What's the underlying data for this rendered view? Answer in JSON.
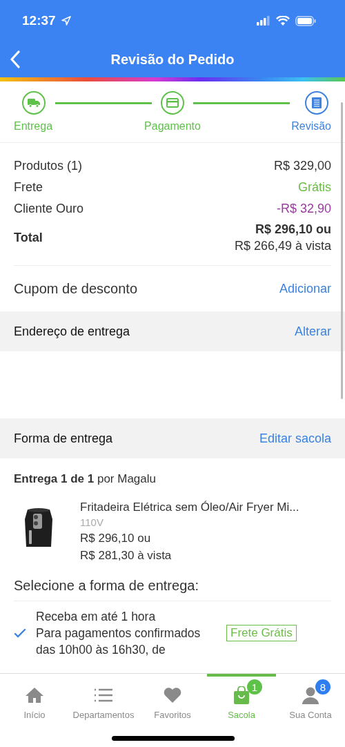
{
  "status_bar": {
    "time": "12:37"
  },
  "header": {
    "title": "Revisão do Pedido"
  },
  "steps": [
    {
      "label": "Entrega",
      "done": true,
      "kind": "truck"
    },
    {
      "label": "Pagamento",
      "done": true,
      "kind": "card"
    },
    {
      "label": "Revisão",
      "done": false,
      "kind": "doc"
    }
  ],
  "summary": [
    {
      "label": "Produtos (1)",
      "value": "R$ 329,00",
      "kind": "plain"
    },
    {
      "label": "Frete",
      "value": "Grátis",
      "kind": "free"
    },
    {
      "label": "Cliente Ouro",
      "value": "-R$ 32,90",
      "kind": "discount"
    }
  ],
  "total": {
    "label": "Total",
    "value": "R$ 296,10 ou",
    "cash": "R$ 266,49 à vista"
  },
  "coupon": {
    "label": "Cupom de desconto",
    "action": "Adicionar"
  },
  "address": {
    "title": "Endereço de entrega",
    "action": "Alterar"
  },
  "delivery": {
    "title": "Forma de entrega",
    "action": "Editar sacola",
    "shipment": "Entrega 1 de 1",
    "seller": "por Magalu"
  },
  "product": {
    "name": "Fritadeira Elétrica sem Óleo/Air Fryer Mi...",
    "variant": "110V",
    "price": "R$ 296,10 ou",
    "cash": "R$ 281,30 à vista"
  },
  "options_title": "Selecione a forma de entrega:",
  "options": [
    {
      "title": "Receba em até 1 hora",
      "description": "Para pagamentos confirmados das 10h00 às 16h30, de",
      "tag": "Frete Grátis",
      "selected": true
    }
  ],
  "tab_bar": [
    {
      "label": "Início",
      "kind": "home",
      "selected": false
    },
    {
      "label": "Departamentos",
      "kind": "list",
      "selected": false
    },
    {
      "label": "Favoritos",
      "kind": "heart",
      "selected": false
    },
    {
      "label": "Sacola",
      "kind": "bag",
      "selected": true,
      "badge": "1"
    },
    {
      "label": "Sua Conta",
      "kind": "person",
      "selected": false,
      "badge": "8"
    }
  ]
}
